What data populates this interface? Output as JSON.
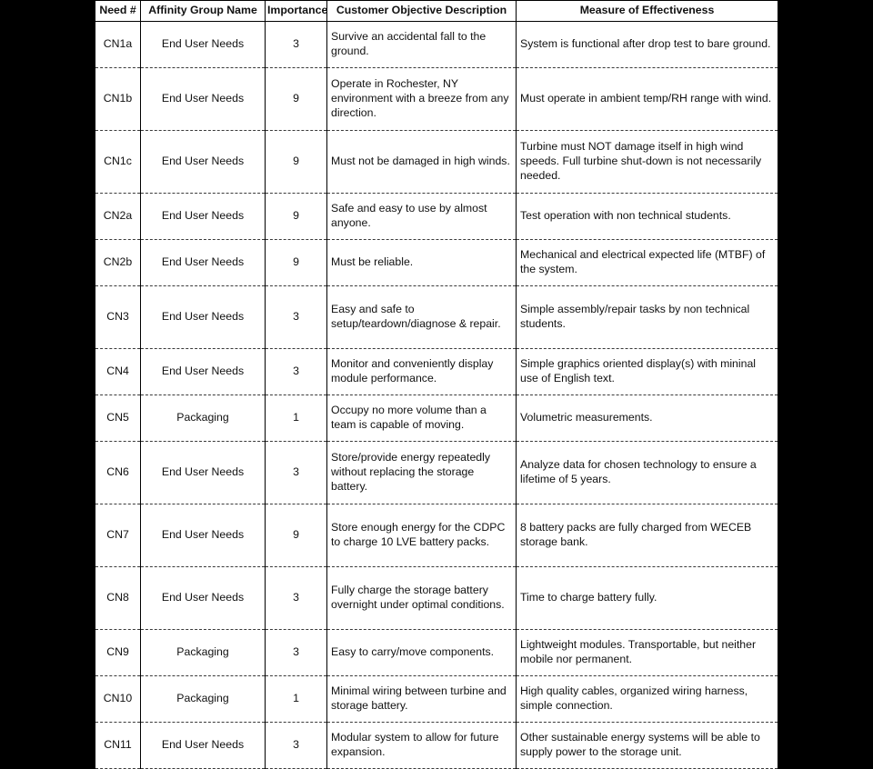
{
  "table": {
    "headers": {
      "need": "Need #",
      "affinity": "Affinity Group Name",
      "importance": "Importance",
      "description": "Customer Objective Description",
      "measure": "Measure of Effectiveness"
    },
    "rows": [
      {
        "need": "CN1a",
        "affinity": "End User Needs",
        "importance": "3",
        "description": "Survive an accidental fall to the ground.",
        "measure": "System is functional after drop test to bare ground."
      },
      {
        "need": "CN1b",
        "affinity": "End User Needs",
        "importance": "9",
        "description": "Operate in Rochester, NY environment with a breeze from any direction.",
        "measure": "Must operate in ambient temp/RH range with wind."
      },
      {
        "need": "CN1c",
        "affinity": "End User Needs",
        "importance": "9",
        "description": "Must not be damaged in high winds.",
        "measure": "Turbine must NOT damage itself in high wind speeds.  Full turbine shut-down is not necessarily needed."
      },
      {
        "need": "CN2a",
        "affinity": "End User Needs",
        "importance": "9",
        "description": "Safe and easy to use by almost anyone.",
        "measure": "Test operation with non technical students."
      },
      {
        "need": "CN2b",
        "affinity": "End User Needs",
        "importance": "9",
        "description": "Must be reliable.",
        "measure": "Mechanical and electrical expected life (MTBF) of the system."
      },
      {
        "need": "CN3",
        "affinity": "End User Needs",
        "importance": "3",
        "description": "Easy and safe to setup/teardown/diagnose & repair.",
        "measure": "Simple assembly/repair tasks by non technical students."
      },
      {
        "need": "CN4",
        "affinity": "End User Needs",
        "importance": "3",
        "description": "Monitor and conveniently display module performance.",
        "measure": "Simple graphics oriented display(s) with mininal use of English text."
      },
      {
        "need": "CN5",
        "affinity": "Packaging",
        "importance": "1",
        "description": "Occupy no more volume than a team is capable of moving.",
        "measure": "Volumetric measurements."
      },
      {
        "need": "CN6",
        "affinity": "End User Needs",
        "importance": "3",
        "description": "Store/provide energy repeatedly without replacing the storage battery.",
        "measure": "Analyze data for chosen technology to ensure a lifetime of 5 years."
      },
      {
        "need": "CN7",
        "affinity": "End User Needs",
        "importance": "9",
        "description": "Store enough energy for the CDPC to charge 10 LVE battery packs.",
        "measure": "8 battery packs are fully charged from WECEB storage bank."
      },
      {
        "need": "CN8",
        "affinity": "End User Needs",
        "importance": "3",
        "description": "Fully charge the storage battery overnight under optimal conditions.",
        "measure": "Time to charge battery fully."
      },
      {
        "need": "CN9",
        "affinity": "Packaging",
        "importance": "3",
        "description": "Easy to carry/move components.",
        "measure": "Lightweight modules.  Transportable, but neither mobile nor permanent."
      },
      {
        "need": "CN10",
        "affinity": "Packaging",
        "importance": "1",
        "description": "Minimal wiring between turbine and storage battery.",
        "measure": "High quality cables, organized wiring harness, simple connection."
      },
      {
        "need": "CN11",
        "affinity": "End User Needs",
        "importance": "3",
        "description": "Modular system to allow for future expansion.",
        "measure": "Other sustainable energy systems will be able to supply power to the storage unit."
      }
    ]
  }
}
